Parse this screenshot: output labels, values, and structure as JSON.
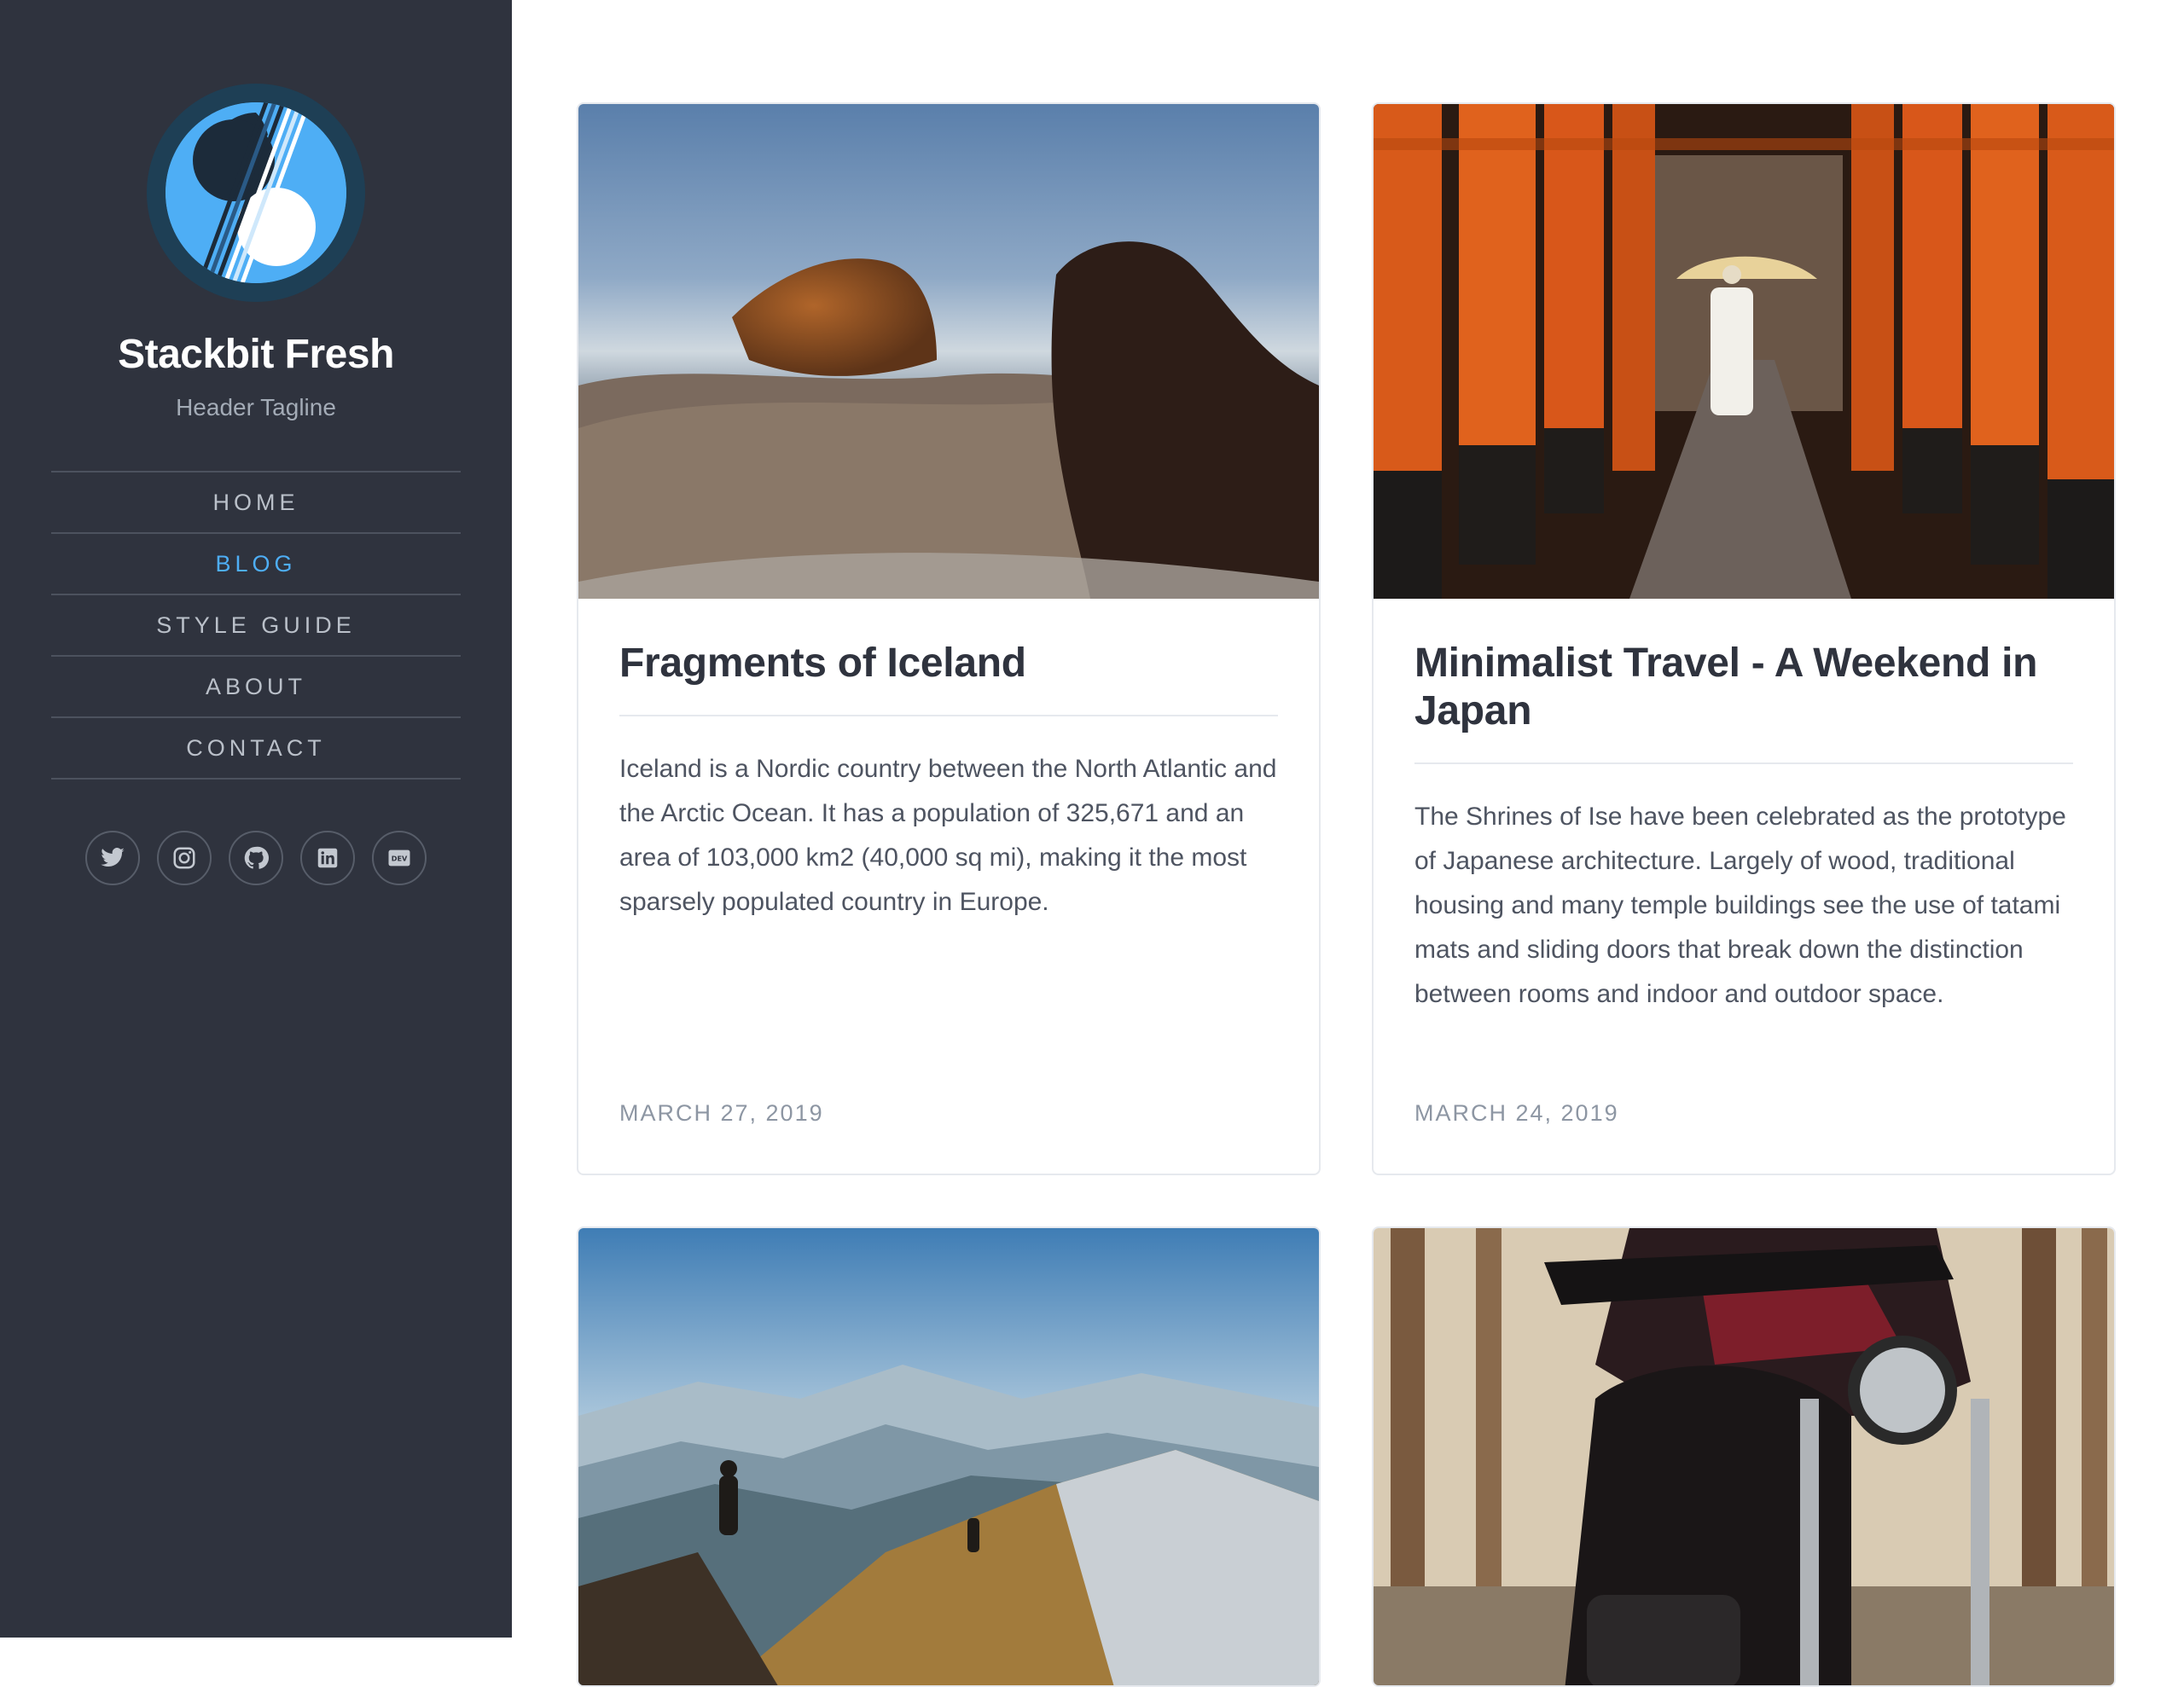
{
  "site": {
    "title": "Stackbit Fresh",
    "tagline": "Header Tagline",
    "logo_icon": "stackbit-logo-icon"
  },
  "nav": {
    "items": [
      {
        "label": "HOME",
        "active": false
      },
      {
        "label": "BLOG",
        "active": true
      },
      {
        "label": "STYLE GUIDE",
        "active": false
      },
      {
        "label": "ABOUT",
        "active": false
      },
      {
        "label": "CONTACT",
        "active": false
      }
    ]
  },
  "social": [
    "twitter-icon",
    "instagram-icon",
    "github-icon",
    "linkedin-icon",
    "dev-icon"
  ],
  "posts": [
    {
      "title": "Fragments of Iceland",
      "excerpt": "Iceland is a Nordic country between the North Atlantic and the Arctic Ocean. It has a population of 325,671 and an area of 103,000 km2 (40,000 sq mi), making it the most sparsely populated country in Europe.",
      "date": "MARCH 27, 2019",
      "image": "icelandic-horses-photo"
    },
    {
      "title": "Minimalist Travel - A Weekend in Japan",
      "excerpt": "The Shrines of Ise have been celebrated as the prototype of Japanese architecture. Largely of wood, traditional housing and many temple buildings see the use of tatami mats and sliding doors that break down the distinction between rooms and indoor and outdoor space.",
      "date": "MARCH 24, 2019",
      "image": "torii-gate-tunnel-photo"
    },
    {
      "title": "",
      "excerpt": "",
      "date": "",
      "image": "mountain-hikers-photo"
    },
    {
      "title": "",
      "excerpt": "",
      "date": "",
      "image": "motorcycle-forest-photo"
    }
  ],
  "colors": {
    "sidebar_bg": "#2f333e",
    "accent": "#4eaef5",
    "text_dark": "#2f333e",
    "text_muted": "#8d96a3"
  }
}
